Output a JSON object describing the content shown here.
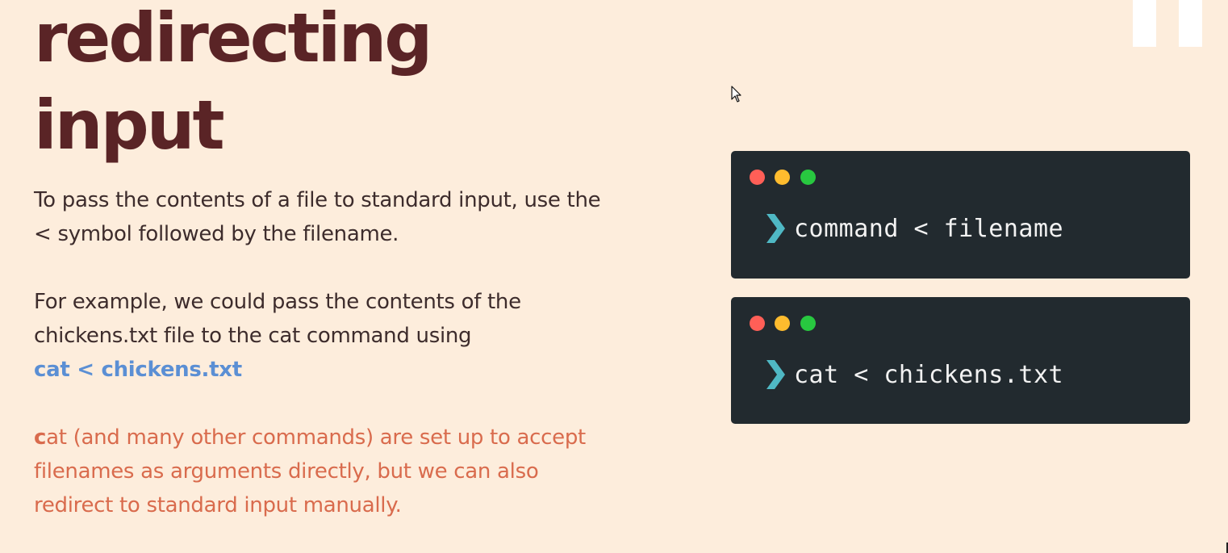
{
  "slide": {
    "title_line1": "redirecting",
    "title_line2": "input",
    "paragraph1": {
      "line1": "To pass the contents of a file to standard input, use the",
      "line2": "< symbol followed by the filename."
    },
    "paragraph2": {
      "line1": "For example, we could pass the contents of the",
      "line2": "chickens.txt file to the cat command using",
      "code_example": "cat < chickens.txt"
    },
    "paragraph3": {
      "first_letter": "c",
      "line1_rest": "at (and many other commands) are set up to accept",
      "line2": "filenames as arguments directly, but we can also",
      "line3": "redirect to standard input manually."
    }
  },
  "terminals": [
    {
      "command": "command < filename"
    },
    {
      "command": "cat < chickens.txt"
    }
  ],
  "icons": {
    "prompt": "chevron-right-icon",
    "window_controls": [
      "close-dot-icon",
      "minimize-dot-icon",
      "maximize-dot-icon"
    ],
    "pointer": "mouse-cursor-icon"
  },
  "colors": {
    "background": "#fdeddc",
    "title": "#5a2426",
    "body_text": "#3d2c2c",
    "code_example": "#5b8fd4",
    "note_text": "#d96b4d",
    "terminal_bg": "#222a2f",
    "prompt_chevron": "#4fb8c4",
    "dot_red": "#ff5f57",
    "dot_yellow": "#febc2e",
    "dot_green": "#28c840"
  }
}
